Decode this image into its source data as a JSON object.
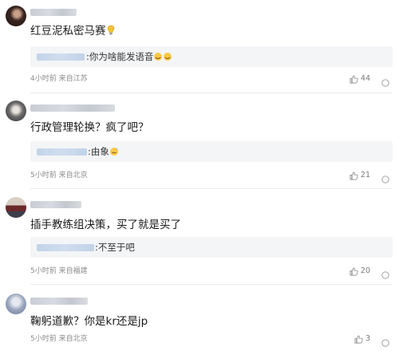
{
  "comments": [
    {
      "content": "红豆泥私密马赛",
      "content_emoji": "lightbulb-icon",
      "reply_text": ":你为啥能发语音",
      "reply_emoji": "laughing-emoji-icon",
      "time": "4小时前",
      "location": "来自江苏",
      "likes": "44"
    },
    {
      "content": "行政管理轮换？疯了吧？",
      "reply_text": ":由象",
      "reply_emoji": "sweat-emoji-icon",
      "time": "5小时前",
      "location": "来自北京",
      "likes": "21"
    },
    {
      "content": "插手教练组决策，买了就是买了",
      "reply_text": ":不至于吧",
      "time": "5小时前",
      "location": "来自福建",
      "likes": "20"
    },
    {
      "content": "鞠躬道歉？你是kr还是jp",
      "time": "5小时前",
      "location": "来自北京",
      "likes": "3"
    }
  ]
}
